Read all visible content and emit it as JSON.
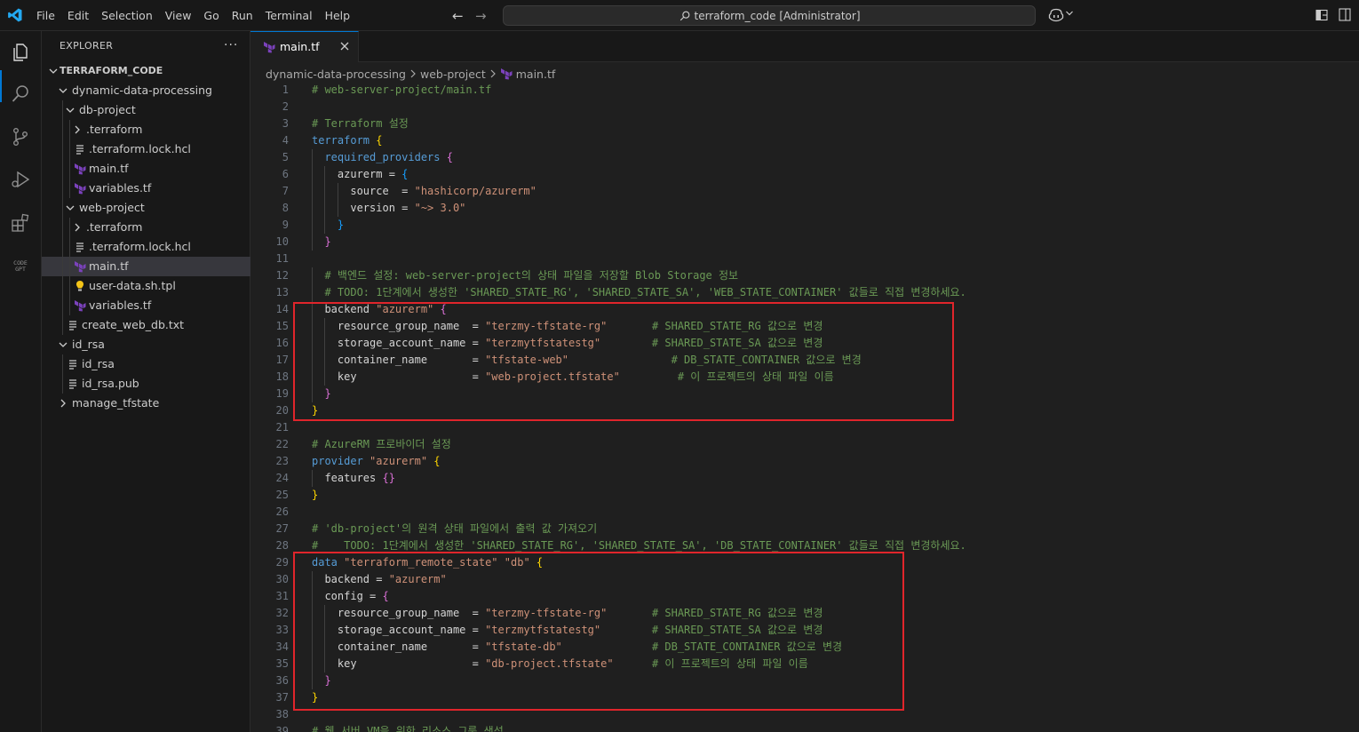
{
  "window": {
    "title": "terraform_code [Administrator]"
  },
  "menu": [
    "File",
    "Edit",
    "Selection",
    "View",
    "Go",
    "Run",
    "Terminal",
    "Help"
  ],
  "explorer": {
    "title": "EXPLORER",
    "more": "···",
    "tree": [
      {
        "label": "TERRAFORM_CODE",
        "kind": "root",
        "depth": 0,
        "icon": "chevron-down-icon"
      },
      {
        "label": "dynamic-data-processing",
        "kind": "folder-open",
        "depth": 1,
        "icon": "chevron-down-icon"
      },
      {
        "label": "db-project",
        "kind": "folder-open",
        "depth": 2,
        "icon": "chevron-down-icon"
      },
      {
        "label": ".terraform",
        "kind": "folder-closed",
        "depth": 3,
        "icon": "chevron-right-icon"
      },
      {
        "label": ".terraform.lock.hcl",
        "kind": "file",
        "depth": 3,
        "icon": "lines-file-icon"
      },
      {
        "label": "main.tf",
        "kind": "file",
        "depth": 3,
        "icon": "terraform-icon"
      },
      {
        "label": "variables.tf",
        "kind": "file",
        "depth": 3,
        "icon": "terraform-icon"
      },
      {
        "label": "web-project",
        "kind": "folder-open",
        "depth": 2,
        "icon": "chevron-down-icon"
      },
      {
        "label": ".terraform",
        "kind": "folder-closed",
        "depth": 3,
        "icon": "chevron-right-icon"
      },
      {
        "label": ".terraform.lock.hcl",
        "kind": "file",
        "depth": 3,
        "icon": "lines-file-icon"
      },
      {
        "label": "main.tf",
        "kind": "file",
        "depth": 3,
        "icon": "terraform-icon",
        "selected": true
      },
      {
        "label": "user-data.sh.tpl",
        "kind": "file",
        "depth": 3,
        "icon": "lightbulb-icon"
      },
      {
        "label": "variables.tf",
        "kind": "file",
        "depth": 3,
        "icon": "terraform-icon"
      },
      {
        "label": "create_web_db.txt",
        "kind": "file",
        "depth": 2,
        "icon": "lines-file-icon"
      },
      {
        "label": "id_rsa",
        "kind": "folder-open",
        "depth": 1,
        "icon": "chevron-down-icon"
      },
      {
        "label": "id_rsa",
        "kind": "file",
        "depth": 2,
        "icon": "lines-file-icon"
      },
      {
        "label": "id_rsa.pub",
        "kind": "file",
        "depth": 2,
        "icon": "lines-file-icon"
      },
      {
        "label": "manage_tfstate",
        "kind": "folder-closed",
        "depth": 1,
        "icon": "chevron-right-icon"
      }
    ]
  },
  "editor": {
    "tab": {
      "label": "main.tf"
    },
    "breadcrumb": [
      "dynamic-data-processing",
      "web-project",
      "main.tf"
    ],
    "lines": [
      [
        [
          "t-comment",
          "# web-server-project/main.tf"
        ]
      ],
      [],
      [
        [
          "t-comment",
          "# Terraform 설정"
        ]
      ],
      [
        [
          "t-kw",
          "terraform"
        ],
        [
          "t-plain",
          " "
        ],
        [
          "t-br1",
          "{"
        ]
      ],
      [
        [
          "t-plain",
          "  "
        ],
        [
          "t-kw",
          "required_providers"
        ],
        [
          "t-plain",
          " "
        ],
        [
          "t-br2",
          "{"
        ]
      ],
      [
        [
          "t-plain",
          "    azurerm = "
        ],
        [
          "t-br3",
          "{"
        ]
      ],
      [
        [
          "t-plain",
          "      source  = "
        ],
        [
          "t-str",
          "\"hashicorp/azurerm\""
        ]
      ],
      [
        [
          "t-plain",
          "      version = "
        ],
        [
          "t-str",
          "\"~> 3.0\""
        ]
      ],
      [
        [
          "t-plain",
          "    "
        ],
        [
          "t-br3",
          "}"
        ]
      ],
      [
        [
          "t-plain",
          "  "
        ],
        [
          "t-br2",
          "}"
        ]
      ],
      [],
      [
        [
          "t-plain",
          "  "
        ],
        [
          "t-comment",
          "# 백엔드 설정: web-server-project의 상태 파일을 저장할 Blob Storage 정보"
        ]
      ],
      [
        [
          "t-plain",
          "  "
        ],
        [
          "t-comment",
          "# TODO: 1단계에서 생성한 'SHARED_STATE_RG', 'SHARED_STATE_SA', 'WEB_STATE_CONTAINER' 값들로 직접 변경하세요."
        ]
      ],
      [
        [
          "t-plain",
          "  backend "
        ],
        [
          "t-str",
          "\"azurerm\""
        ],
        [
          "t-plain",
          " "
        ],
        [
          "t-br2",
          "{"
        ]
      ],
      [
        [
          "t-plain",
          "    resource_group_name  = "
        ],
        [
          "t-str",
          "\"terzmy-tfstate-rg\""
        ],
        [
          "t-plain",
          "       "
        ],
        [
          "t-comment",
          "# SHARED_STATE_RG 값으로 변경"
        ]
      ],
      [
        [
          "t-plain",
          "    storage_account_name = "
        ],
        [
          "t-str",
          "\"terzmytfstatestg\""
        ],
        [
          "t-plain",
          "        "
        ],
        [
          "t-comment",
          "# SHARED_STATE_SA 값으로 변경"
        ]
      ],
      [
        [
          "t-plain",
          "    container_name       = "
        ],
        [
          "t-str",
          "\"tfstate-web\""
        ],
        [
          "t-plain",
          "                "
        ],
        [
          "t-comment",
          "# DB_STATE_CONTAINER 값으로 변경"
        ]
      ],
      [
        [
          "t-plain",
          "    key                  = "
        ],
        [
          "t-str",
          "\"web-project.tfstate\""
        ],
        [
          "t-plain",
          "         "
        ],
        [
          "t-comment",
          "# 이 프로젝트의 상태 파일 이름"
        ]
      ],
      [
        [
          "t-plain",
          "  "
        ],
        [
          "t-br2",
          "}"
        ]
      ],
      [
        [
          "t-br1",
          "}"
        ]
      ],
      [],
      [
        [
          "t-comment",
          "# AzureRM 프로바이더 설정"
        ]
      ],
      [
        [
          "t-kw",
          "provider"
        ],
        [
          "t-plain",
          " "
        ],
        [
          "t-str",
          "\"azurerm\""
        ],
        [
          "t-plain",
          " "
        ],
        [
          "t-br1",
          "{"
        ]
      ],
      [
        [
          "t-plain",
          "  features "
        ],
        [
          "t-br2",
          "{}"
        ]
      ],
      [
        [
          "t-br1",
          "}"
        ]
      ],
      [],
      [
        [
          "t-comment",
          "# 'db-project'의 원격 상태 파일에서 출력 값 가져오기"
        ]
      ],
      [
        [
          "t-comment",
          "#    TODO: 1단계에서 생성한 'SHARED_STATE_RG', 'SHARED_STATE_SA', 'DB_STATE_CONTAINER' 값들로 직접 변경하세요."
        ]
      ],
      [
        [
          "t-kw",
          "data"
        ],
        [
          "t-plain",
          " "
        ],
        [
          "t-str",
          "\"terraform_remote_state\""
        ],
        [
          "t-plain",
          " "
        ],
        [
          "t-str",
          "\"db\""
        ],
        [
          "t-plain",
          " "
        ],
        [
          "t-br1",
          "{"
        ]
      ],
      [
        [
          "t-plain",
          "  backend = "
        ],
        [
          "t-str",
          "\"azurerm\""
        ]
      ],
      [
        [
          "t-plain",
          "  config = "
        ],
        [
          "t-br2",
          "{"
        ]
      ],
      [
        [
          "t-plain",
          "    resource_group_name  = "
        ],
        [
          "t-str",
          "\"terzmy-tfstate-rg\""
        ],
        [
          "t-plain",
          "       "
        ],
        [
          "t-comment",
          "# SHARED_STATE_RG 값으로 변경"
        ]
      ],
      [
        [
          "t-plain",
          "    storage_account_name = "
        ],
        [
          "t-str",
          "\"terzmytfstatestg\""
        ],
        [
          "t-plain",
          "        "
        ],
        [
          "t-comment",
          "# SHARED_STATE_SA 값으로 변경"
        ]
      ],
      [
        [
          "t-plain",
          "    container_name       = "
        ],
        [
          "t-str",
          "\"tfstate-db\""
        ],
        [
          "t-plain",
          "              "
        ],
        [
          "t-comment",
          "# DB_STATE_CONTAINER 값으로 변경"
        ]
      ],
      [
        [
          "t-plain",
          "    key                  = "
        ],
        [
          "t-str",
          "\"db-project.tfstate\""
        ],
        [
          "t-plain",
          "      "
        ],
        [
          "t-comment",
          "# 이 프로젝트의 상태 파일 이름"
        ]
      ],
      [
        [
          "t-plain",
          "  "
        ],
        [
          "t-br2",
          "}"
        ]
      ],
      [
        [
          "t-br1",
          "}"
        ]
      ],
      [],
      [
        [
          "t-comment",
          "# 웹 서버 VM을 위한 리소스 그룹 생성"
        ]
      ]
    ]
  },
  "colors": {
    "accent": "#0078d4",
    "highlight_box": "#e0252b",
    "terraform": "#7b42bc"
  }
}
